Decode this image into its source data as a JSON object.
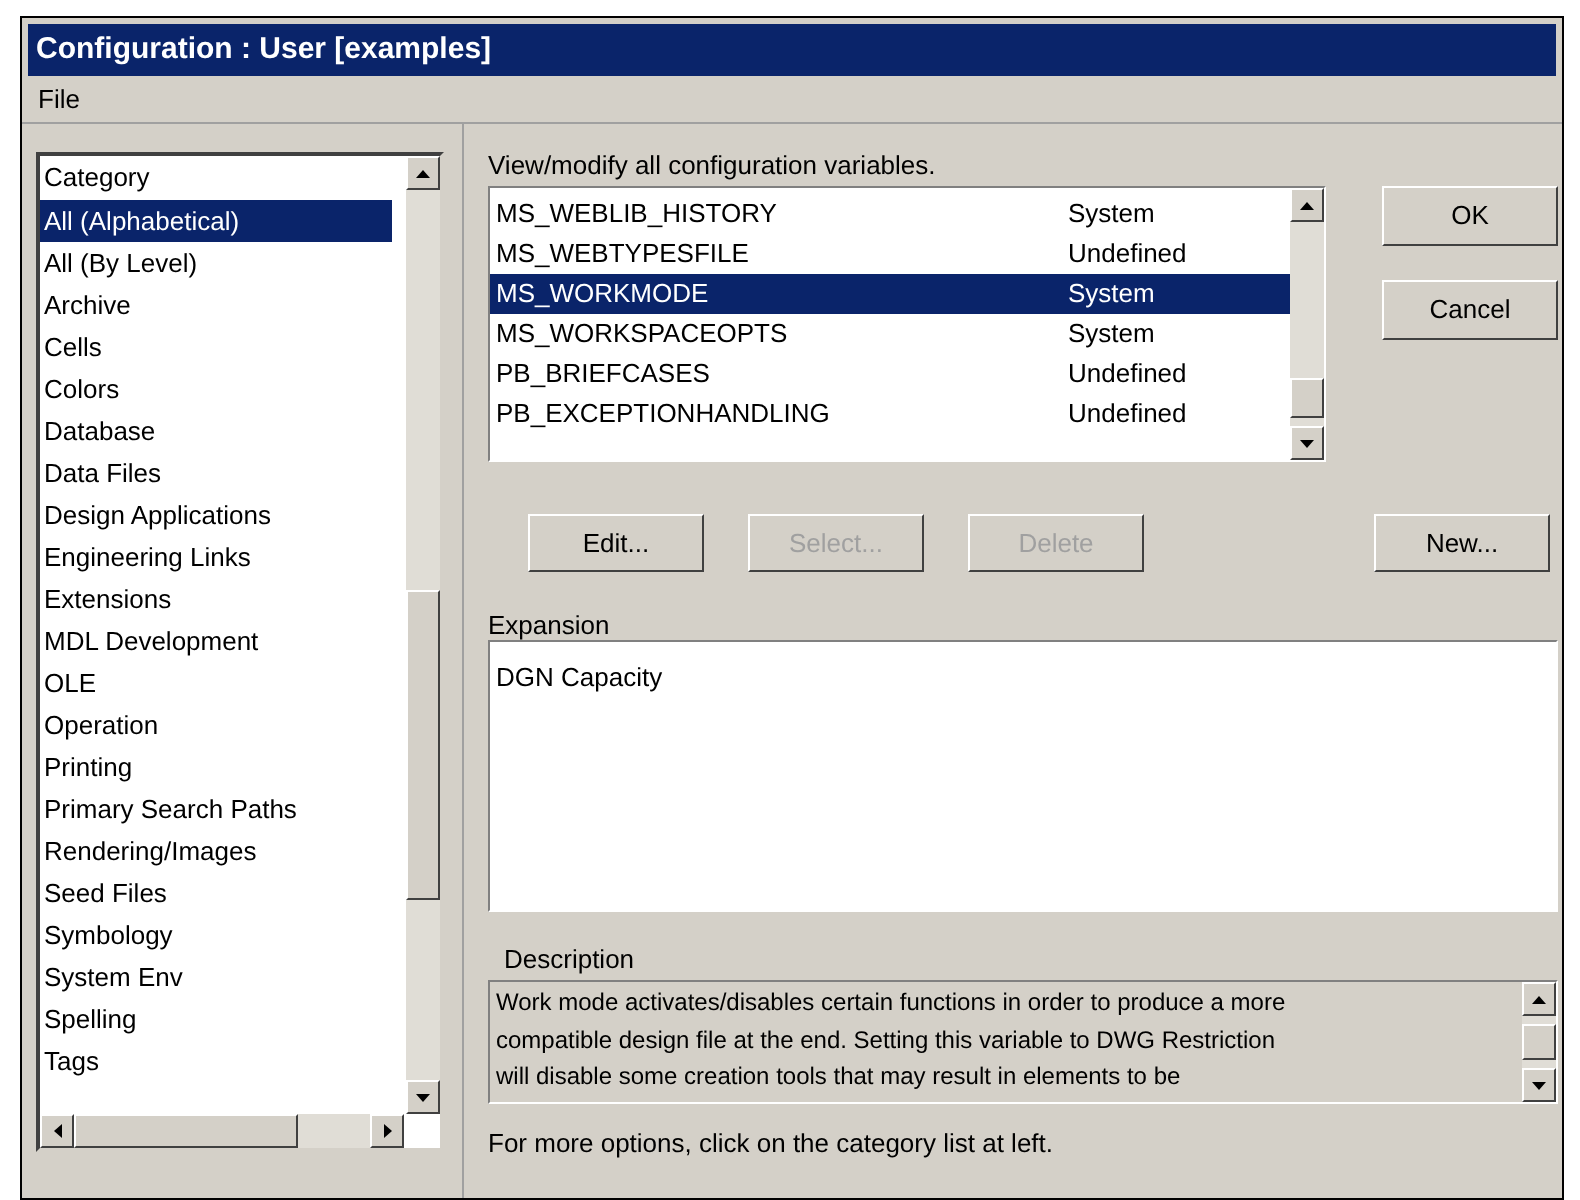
{
  "window": {
    "title": "Configuration : User [examples]"
  },
  "menu": [
    "File"
  ],
  "category_list": {
    "header": "Category",
    "items": [
      {
        "label": "All (Alphabetical)",
        "selected": true
      },
      {
        "label": "All (By Level)",
        "selected": false
      },
      {
        "label": "Archive",
        "selected": false
      },
      {
        "label": "Cells",
        "selected": false
      },
      {
        "label": "Colors",
        "selected": false
      },
      {
        "label": "Database",
        "selected": false
      },
      {
        "label": "Data Files",
        "selected": false
      },
      {
        "label": "Design Applications",
        "selected": false
      },
      {
        "label": "Engineering Links",
        "selected": false
      },
      {
        "label": "Extensions",
        "selected": false
      },
      {
        "label": "MDL Development",
        "selected": false
      },
      {
        "label": "OLE",
        "selected": false
      },
      {
        "label": "Operation",
        "selected": false
      },
      {
        "label": "Printing",
        "selected": false
      },
      {
        "label": "Primary Search Paths",
        "selected": false
      },
      {
        "label": "Rendering/Images",
        "selected": false
      },
      {
        "label": "Seed Files",
        "selected": false
      },
      {
        "label": "Symbology",
        "selected": false
      },
      {
        "label": "System Env",
        "selected": false
      },
      {
        "label": "Spelling",
        "selected": false
      },
      {
        "label": "Tags",
        "selected": false
      }
    ]
  },
  "instruction": "View/modify all configuration variables.",
  "variables": [
    {
      "name": "MS_WEBLIB_HISTORY",
      "level": "System",
      "selected": false
    },
    {
      "name": "MS_WEBTYPESFILE",
      "level": "Undefined",
      "selected": false
    },
    {
      "name": "MS_WORKMODE",
      "level": "System",
      "selected": true
    },
    {
      "name": "MS_WORKSPACEOPTS",
      "level": "System",
      "selected": false
    },
    {
      "name": "PB_BRIEFCASES",
      "level": "Undefined",
      "selected": false
    },
    {
      "name": "PB_EXCEPTIONHANDLING",
      "level": "Undefined",
      "selected": false
    }
  ],
  "side_buttons": [
    "OK",
    "Cancel"
  ],
  "action_buttons": [
    {
      "label": "Edit...",
      "disabled": false
    },
    {
      "label": "Select...",
      "disabled": true
    },
    {
      "label": "Delete",
      "disabled": true
    }
  ],
  "new_button": "New...",
  "expansion": {
    "label": "Expansion",
    "value": "DGN Capacity"
  },
  "description": {
    "label": "Description",
    "lines": [
      "Work mode activates/disables certain functions in order to produce a more",
      "compatible design file at the end.  Setting this variable to DWG Restriction",
      "will disable some creation tools that may result in elements to be"
    ]
  },
  "footer": "For more options, click on the category list at left."
}
